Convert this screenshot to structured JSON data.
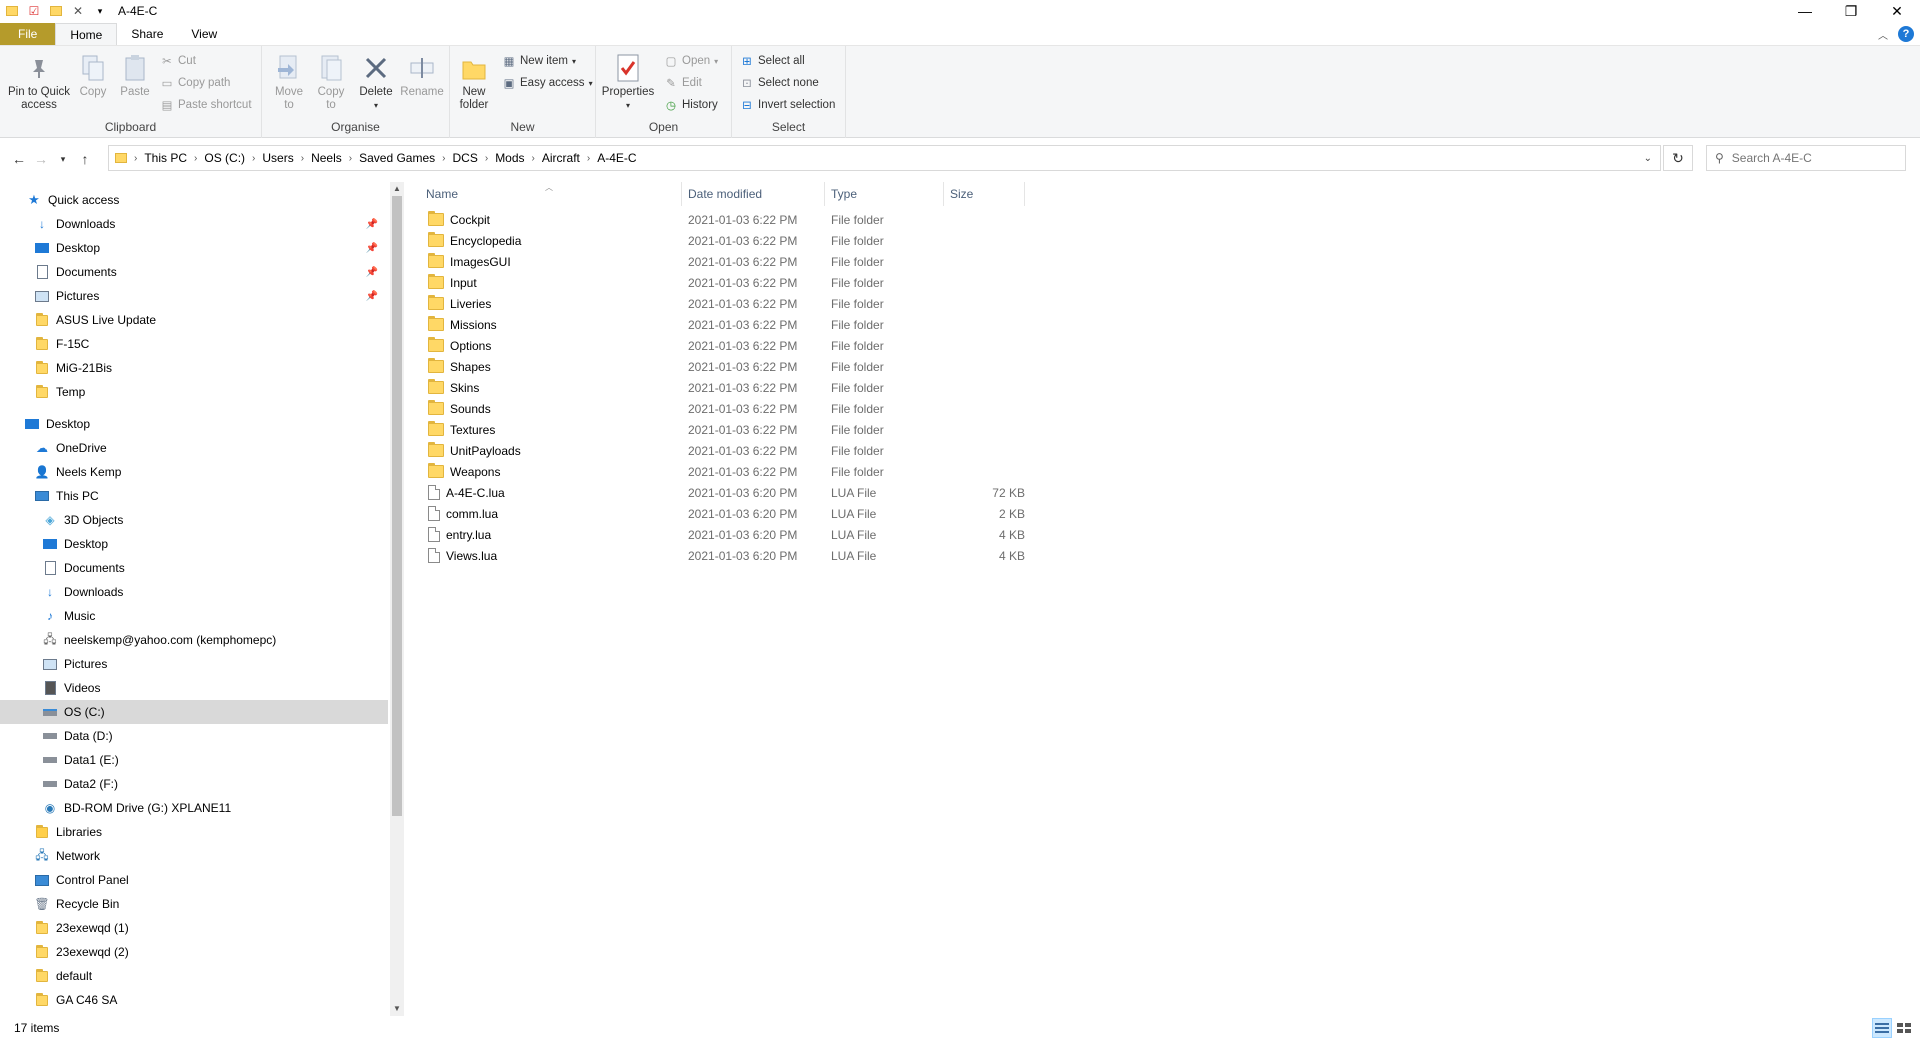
{
  "window": {
    "title": "A-4E-C"
  },
  "ribbon_tabs": [
    "File",
    "Home",
    "Share",
    "View"
  ],
  "ribbon": {
    "clipboard": {
      "label": "Clipboard",
      "pin": "Pin to Quick access",
      "pin_l1": "Pin to Quick",
      "pin_l2": "access",
      "copy": "Copy",
      "paste": "Paste",
      "cut": "Cut",
      "copy_path": "Copy path",
      "paste_shortcut": "Paste shortcut"
    },
    "organise": {
      "label": "Organise",
      "move_l1": "Move",
      "move_l2": "to",
      "copy_l1": "Copy",
      "copy_l2": "to",
      "delete": "Delete",
      "rename": "Rename"
    },
    "new": {
      "label": "New",
      "new_folder_l1": "New",
      "new_folder_l2": "folder",
      "new_item": "New item",
      "easy_access": "Easy access"
    },
    "open": {
      "label": "Open",
      "properties": "Properties",
      "open": "Open",
      "edit": "Edit",
      "history": "History"
    },
    "select": {
      "label": "Select",
      "select_all": "Select all",
      "select_none": "Select none",
      "invert": "Invert selection"
    }
  },
  "address": {
    "crumbs": [
      "This PC",
      "OS (C:)",
      "Users",
      "Neels",
      "Saved Games",
      "DCS",
      "Mods",
      "Aircraft",
      "A-4E-C"
    ],
    "search_placeholder": "Search A-4E-C"
  },
  "nav": {
    "quick_access": "Quick access",
    "qa_items": [
      "Downloads",
      "Desktop",
      "Documents",
      "Pictures",
      "ASUS Live Update",
      "F-15C",
      "MiG-21Bis",
      "Temp"
    ],
    "desktop": "Desktop",
    "onedrive": "OneDrive",
    "user": "Neels Kemp",
    "this_pc": "This PC",
    "pc_items": [
      "3D Objects",
      "Desktop",
      "Documents",
      "Downloads",
      "Music",
      "neelskemp@yahoo.com (kemphomepc)",
      "Pictures",
      "Videos",
      "OS (C:)",
      "Data (D:)",
      "Data1 (E:)",
      "Data2 (F:)",
      "BD-ROM Drive (G:) XPLANE11"
    ],
    "libraries": "Libraries",
    "network": "Network",
    "control_panel": "Control Panel",
    "recycle_bin": "Recycle Bin",
    "extra_items": [
      "23exewqd (1)",
      "23exewqd (2)",
      "default",
      "GA C46 SA"
    ]
  },
  "columns": {
    "name": "Name",
    "date": "Date modified",
    "type": "Type",
    "size": "Size"
  },
  "files": [
    {
      "name": "Cockpit",
      "date": "2021-01-03 6:22 PM",
      "type": "File folder",
      "size": "",
      "kind": "folder"
    },
    {
      "name": "Encyclopedia",
      "date": "2021-01-03 6:22 PM",
      "type": "File folder",
      "size": "",
      "kind": "folder"
    },
    {
      "name": "ImagesGUI",
      "date": "2021-01-03 6:22 PM",
      "type": "File folder",
      "size": "",
      "kind": "folder"
    },
    {
      "name": "Input",
      "date": "2021-01-03 6:22 PM",
      "type": "File folder",
      "size": "",
      "kind": "folder"
    },
    {
      "name": "Liveries",
      "date": "2021-01-03 6:22 PM",
      "type": "File folder",
      "size": "",
      "kind": "folder"
    },
    {
      "name": "Missions",
      "date": "2021-01-03 6:22 PM",
      "type": "File folder",
      "size": "",
      "kind": "folder"
    },
    {
      "name": "Options",
      "date": "2021-01-03 6:22 PM",
      "type": "File folder",
      "size": "",
      "kind": "folder"
    },
    {
      "name": "Shapes",
      "date": "2021-01-03 6:22 PM",
      "type": "File folder",
      "size": "",
      "kind": "folder"
    },
    {
      "name": "Skins",
      "date": "2021-01-03 6:22 PM",
      "type": "File folder",
      "size": "",
      "kind": "folder"
    },
    {
      "name": "Sounds",
      "date": "2021-01-03 6:22 PM",
      "type": "File folder",
      "size": "",
      "kind": "folder"
    },
    {
      "name": "Textures",
      "date": "2021-01-03 6:22 PM",
      "type": "File folder",
      "size": "",
      "kind": "folder"
    },
    {
      "name": "UnitPayloads",
      "date": "2021-01-03 6:22 PM",
      "type": "File folder",
      "size": "",
      "kind": "folder"
    },
    {
      "name": "Weapons",
      "date": "2021-01-03 6:22 PM",
      "type": "File folder",
      "size": "",
      "kind": "folder"
    },
    {
      "name": "A-4E-C.lua",
      "date": "2021-01-03 6:20 PM",
      "type": "LUA File",
      "size": "72 KB",
      "kind": "file"
    },
    {
      "name": "comm.lua",
      "date": "2021-01-03 6:20 PM",
      "type": "LUA File",
      "size": "2 KB",
      "kind": "file"
    },
    {
      "name": "entry.lua",
      "date": "2021-01-03 6:20 PM",
      "type": "LUA File",
      "size": "4 KB",
      "kind": "file"
    },
    {
      "name": "Views.lua",
      "date": "2021-01-03 6:20 PM",
      "type": "LUA File",
      "size": "4 KB",
      "kind": "file"
    }
  ],
  "status": {
    "count": "17 items"
  },
  "colors": {
    "file_tab": "#b59b2b",
    "folder": "#ffd866",
    "selected_nav": "#d9d9d9",
    "accent": "#1e79d6"
  }
}
